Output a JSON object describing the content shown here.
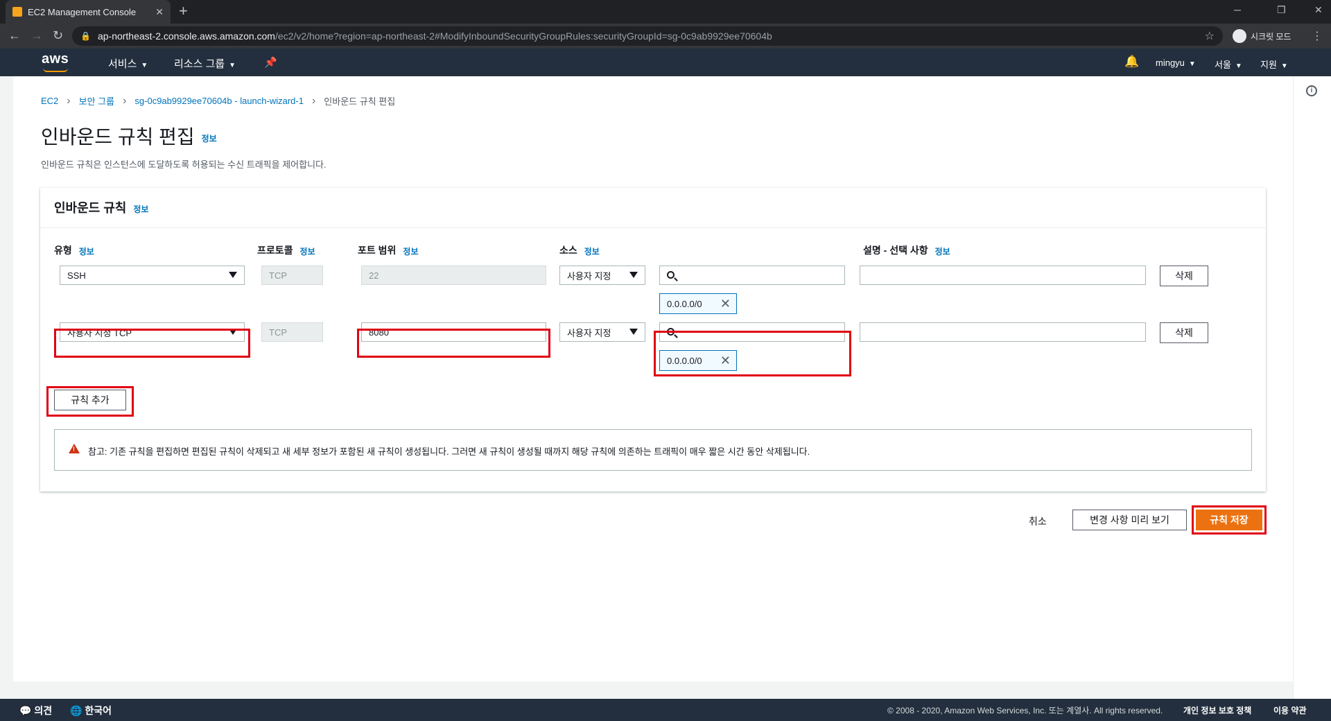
{
  "browser": {
    "tab_title": "EC2 Management Console",
    "new_tab": "+",
    "url_host": "ap-northeast-2.console.aws.amazon.com",
    "url_path": "/ec2/v2/home?region=ap-northeast-2#ModifyInboundSecurityGroupRules:securityGroupId=sg-0c9ab9929ee70604b",
    "incognito_label": "시크릿 모드"
  },
  "aws_nav": {
    "logo": "aws",
    "services": "서비스",
    "resource_groups": "리소스 그룹",
    "user": "mingyu",
    "region": "서울",
    "support": "지원"
  },
  "breadcrumb": {
    "ec2": "EC2",
    "security_groups": "보안 그룹",
    "sg": "sg-0c9ab9929ee70604b - launch-wizard-1",
    "current": "인바운드 규칙 편집"
  },
  "page": {
    "title": "인바운드 규칙 편집",
    "info": "정보",
    "description": "인바운드 규칙은 인스턴스에 도달하도록 허용되는 수신 트래픽을 제어합니다."
  },
  "panel": {
    "title": "인바운드 규칙",
    "info": "정보",
    "columns": {
      "type": "유형",
      "protocol": "프로토콜",
      "port_range": "포트 범위",
      "source": "소스",
      "description": "설명 - 선택 사항",
      "info": "정보"
    },
    "rows": [
      {
        "type": "SSH",
        "protocol": "TCP",
        "port": "22",
        "source": "사용자 지정",
        "cidr": "0.0.0.0/0",
        "desc": "",
        "delete": "삭제"
      },
      {
        "type": "사용자 지정 TCP",
        "protocol": "TCP",
        "port": "8080",
        "source": "사용자 지정",
        "cidr": "0.0.0.0/0",
        "desc": "",
        "delete": "삭제"
      }
    ],
    "add_rule": "규칙 추가",
    "alert": "참고: 기존 규칙을 편집하면 편집된 규칙이 삭제되고 새 세부 정보가 포함된 새 규칙이 생성됩니다. 그러면 새 규칙이 생성될 때까지 해당 규칙에 의존하는 트래픽이 매우 짧은 시간 동안 삭제됩니다."
  },
  "actions": {
    "cancel": "취소",
    "preview": "변경 사항 미리 보기",
    "save": "규칙 저장"
  },
  "footer": {
    "feedback": "의견",
    "language": "한국어",
    "copyright": "© 2008 - 2020, Amazon Web Services, Inc. 또는 계열사. All rights reserved.",
    "privacy": "개인 정보 보호 정책",
    "terms": "이용 약관"
  },
  "colors": {
    "accent": "#ec7211",
    "link": "#0073bb",
    "highlight": "#e00012",
    "nav_bg": "#232f3e"
  }
}
